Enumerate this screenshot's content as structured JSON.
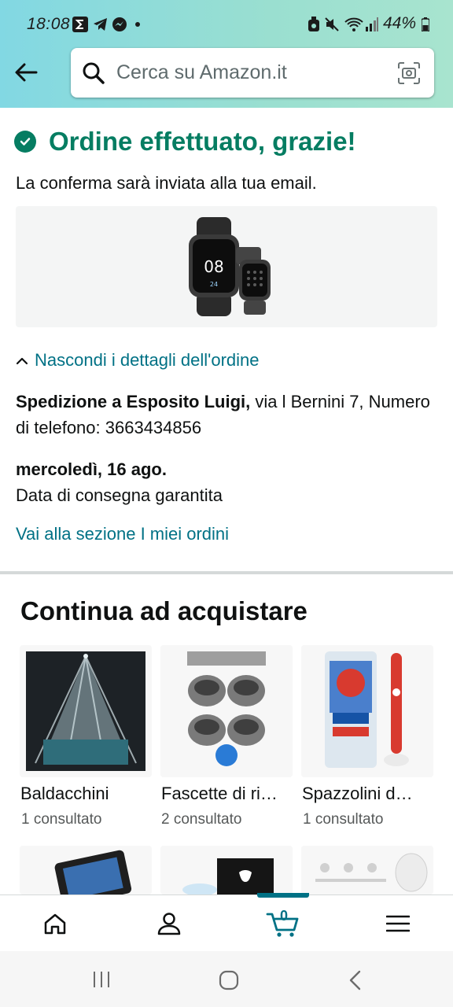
{
  "status_bar": {
    "time": "18:08",
    "battery": "44%",
    "icons": [
      "sigma-app-icon",
      "telegram-icon",
      "messenger-icon",
      "notification-dot-icon",
      "alarm-icon",
      "mute-icon",
      "wifi-icon",
      "signal-icon",
      "battery-icon"
    ]
  },
  "header": {
    "search_placeholder": "Cerca su Amazon.it",
    "icons": [
      "back-arrow-icon",
      "search-icon",
      "camera-scan-icon"
    ]
  },
  "confirmation": {
    "title": "Ordine effettuato, grazie!",
    "subtitle": "La conferma sarà inviata alla tua email.",
    "hide_details": "Nascondi i dettagli dell'ordine",
    "shipping_bold": "Spedizione a Esposito Luigi,",
    "shipping_rest": " via l Bernini 7, Numero di telefono: 3663434856",
    "delivery_date": "mercoledì, 16 ago.",
    "delivery_note": "Data di consegna garantita",
    "orders_link": "Vai alla sezione I miei ordini"
  },
  "continue_shopping": {
    "title": "Continua ad acquistare",
    "items": [
      {
        "title": "Baldacchini",
        "subtitle": "1 consultato"
      },
      {
        "title": "Fascette di ri…",
        "subtitle": "2 consultato"
      },
      {
        "title": "Spazzolini d…",
        "subtitle": "1 consultato"
      }
    ]
  },
  "bottom_nav": {
    "cart_count": "0",
    "items": [
      "home-icon",
      "account-icon",
      "cart-icon",
      "menu-icon"
    ]
  },
  "colors": {
    "accent_green": "#067d62",
    "link_teal": "#007185",
    "header_gradient_start": "#82d8e3",
    "header_gradient_end": "#a8e4cf"
  }
}
